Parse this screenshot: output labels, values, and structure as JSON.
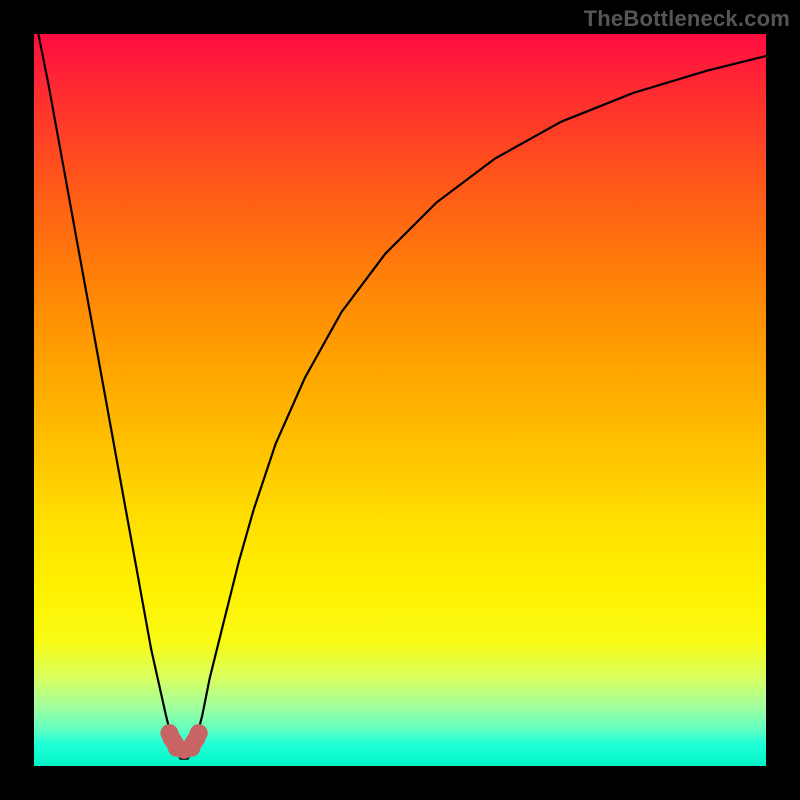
{
  "watermark": {
    "text": "TheBottleneck.com"
  },
  "chart_data": {
    "type": "line",
    "title": "",
    "xlabel": "",
    "ylabel": "",
    "xlim": [
      0,
      100
    ],
    "ylim": [
      0,
      100
    ],
    "legend": false,
    "grid": false,
    "background_gradient": {
      "top_color": "#ff0c40",
      "mid_color": "#ffe000",
      "bottom_color": "#00f5c8"
    },
    "series": [
      {
        "name": "bottleneck-curve",
        "color": "#000000",
        "x": [
          0,
          2,
          4,
          6,
          8,
          10,
          12,
          14,
          16,
          18,
          19,
          20,
          21,
          22,
          23,
          24,
          26,
          28,
          30,
          33,
          37,
          42,
          48,
          55,
          63,
          72,
          82,
          92,
          100
        ],
        "values": [
          103,
          93,
          82,
          71,
          60,
          49,
          38,
          27,
          16,
          7,
          3,
          1,
          1,
          3,
          7,
          12,
          20,
          28,
          35,
          44,
          53,
          62,
          70,
          77,
          83,
          88,
          92,
          95,
          97
        ]
      },
      {
        "name": "optimal-marker",
        "color": "#c86464",
        "type": "scatter",
        "x": [
          18.5,
          19.5,
          20.5,
          21.5,
          22.5,
          18.8,
          22.2,
          19.2,
          21.8
        ],
        "values": [
          4.5,
          2.5,
          2.2,
          2.5,
          4.5,
          3.8,
          3.8,
          3.2,
          3.2
        ]
      }
    ],
    "annotations": []
  }
}
